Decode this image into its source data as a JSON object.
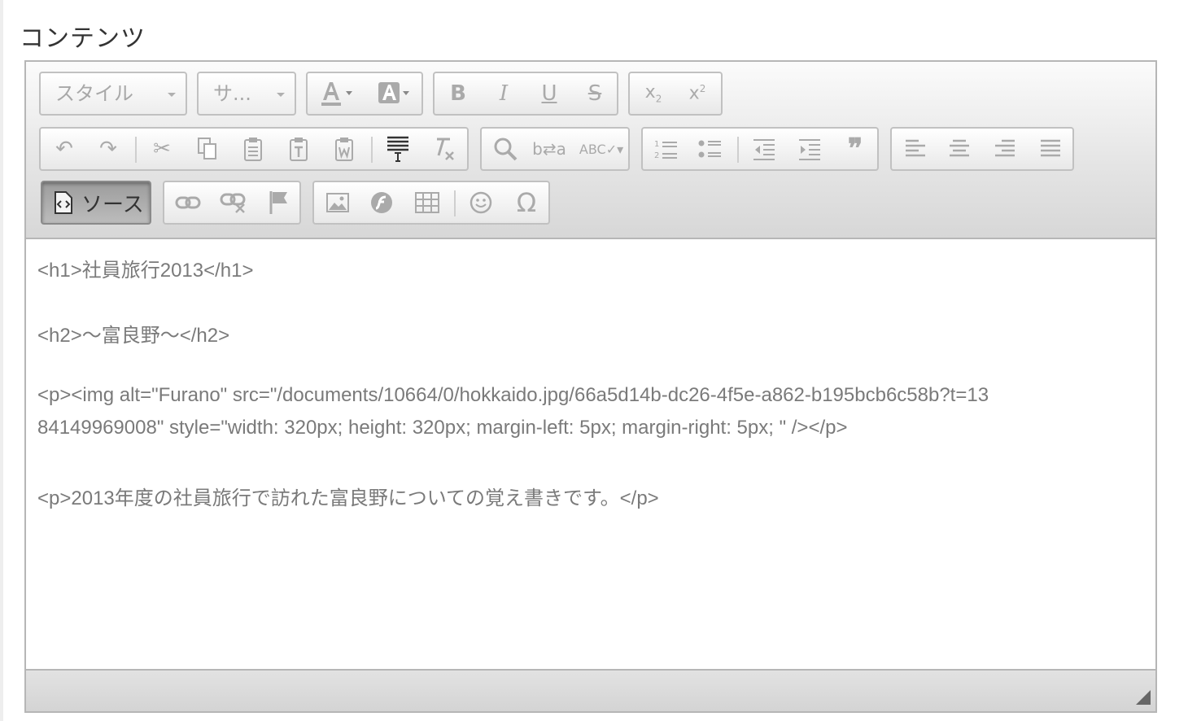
{
  "field": {
    "label": "コンテンツ"
  },
  "toolbar": {
    "styles_combo": "スタイル",
    "size_combo": "サ...",
    "source_label": "ソース"
  },
  "source": {
    "lines": [
      "<h1>社員旅行2013</h1>",
      "<h2>〜富良野〜</h2>",
      "<p><img alt=\"Furano\" src=\"/documents/10664/0/hokkaido.jpg/66a5d14b-dc26-4f5e-a862-b195bcb6c58b?t=13",
      "84149969008\" style=\"width: 320px; height: 320px; margin-left: 5px; margin-right: 5px; \" /></p>",
      "<p>2013年度の社員旅行で訪れた富良野についての覚え書きです。</p>"
    ]
  },
  "colors": {
    "toolbar_icon": "#aaaaaa",
    "source_text": "#7a7a7a",
    "active_button": "#9c9c9c"
  }
}
